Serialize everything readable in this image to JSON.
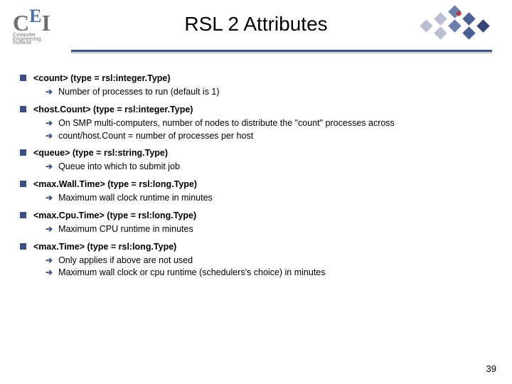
{
  "logo": {
    "l1": "C",
    "l2": "E",
    "l3": "I",
    "sub1": "Computer",
    "sub2": "Engineering",
    "sub3": "Institute"
  },
  "title": "RSL 2 Attributes",
  "items": [
    {
      "title": "<count>  (type = rsl:integer.Type)",
      "subs": [
        "Number of processes to run (default is 1)"
      ]
    },
    {
      "title": "<host.Count> (type = rsl:integer.Type)",
      "subs": [
        "On SMP multi-computers, number of nodes to distribute the \"count\" processes across",
        "count/host.Count = number of processes per host"
      ]
    },
    {
      "title": "<queue> (type = rsl:string.Type)",
      "subs": [
        "Queue into which to submit job"
      ]
    },
    {
      "title": "<max.Wall.Time> (type = rsl:long.Type)",
      "subs": [
        "Maximum wall clock runtime in minutes"
      ]
    },
    {
      "title": "<max.Cpu.Time> (type = rsl:long.Type)",
      "subs": [
        "Maximum CPU runtime in minutes"
      ]
    },
    {
      "title": "<max.Time> (type = rsl:long.Type)",
      "subs": [
        "Only applies if above are not used",
        "Maximum wall clock or cpu runtime (schedulers's choice) in minutes"
      ]
    }
  ],
  "page": "39"
}
